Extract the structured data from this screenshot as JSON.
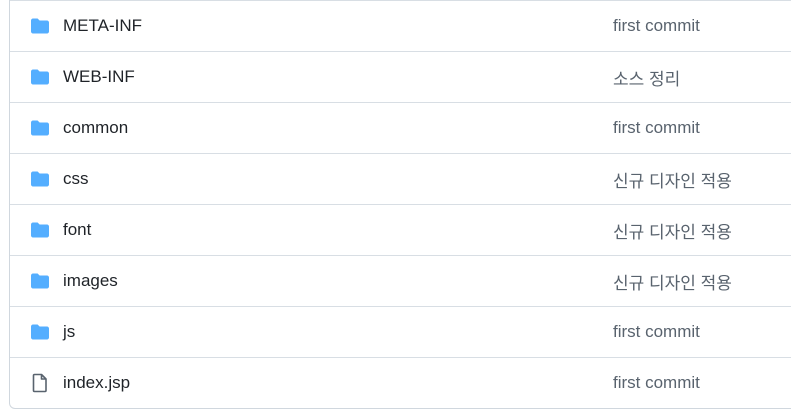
{
  "rows": [
    {
      "type": "folder",
      "name": "META-INF",
      "commit": "first commit"
    },
    {
      "type": "folder",
      "name": "WEB-INF",
      "commit": "소스 정리"
    },
    {
      "type": "folder",
      "name": "common",
      "commit": "first commit"
    },
    {
      "type": "folder",
      "name": "css",
      "commit": "신규 디자인 적용"
    },
    {
      "type": "folder",
      "name": "font",
      "commit": "신규 디자인 적용"
    },
    {
      "type": "folder",
      "name": "images",
      "commit": "신규 디자인 적용"
    },
    {
      "type": "folder",
      "name": "js",
      "commit": "first commit"
    },
    {
      "type": "file",
      "name": "index.jsp",
      "commit": "first commit"
    }
  ],
  "colors": {
    "folder_icon": "#54aeff",
    "file_icon": "#59636e",
    "name_text": "#1f2328",
    "commit_text": "#59636e",
    "border": "#d0d7de"
  },
  "icons": {
    "folder": "folder-icon",
    "file": "file-icon"
  }
}
